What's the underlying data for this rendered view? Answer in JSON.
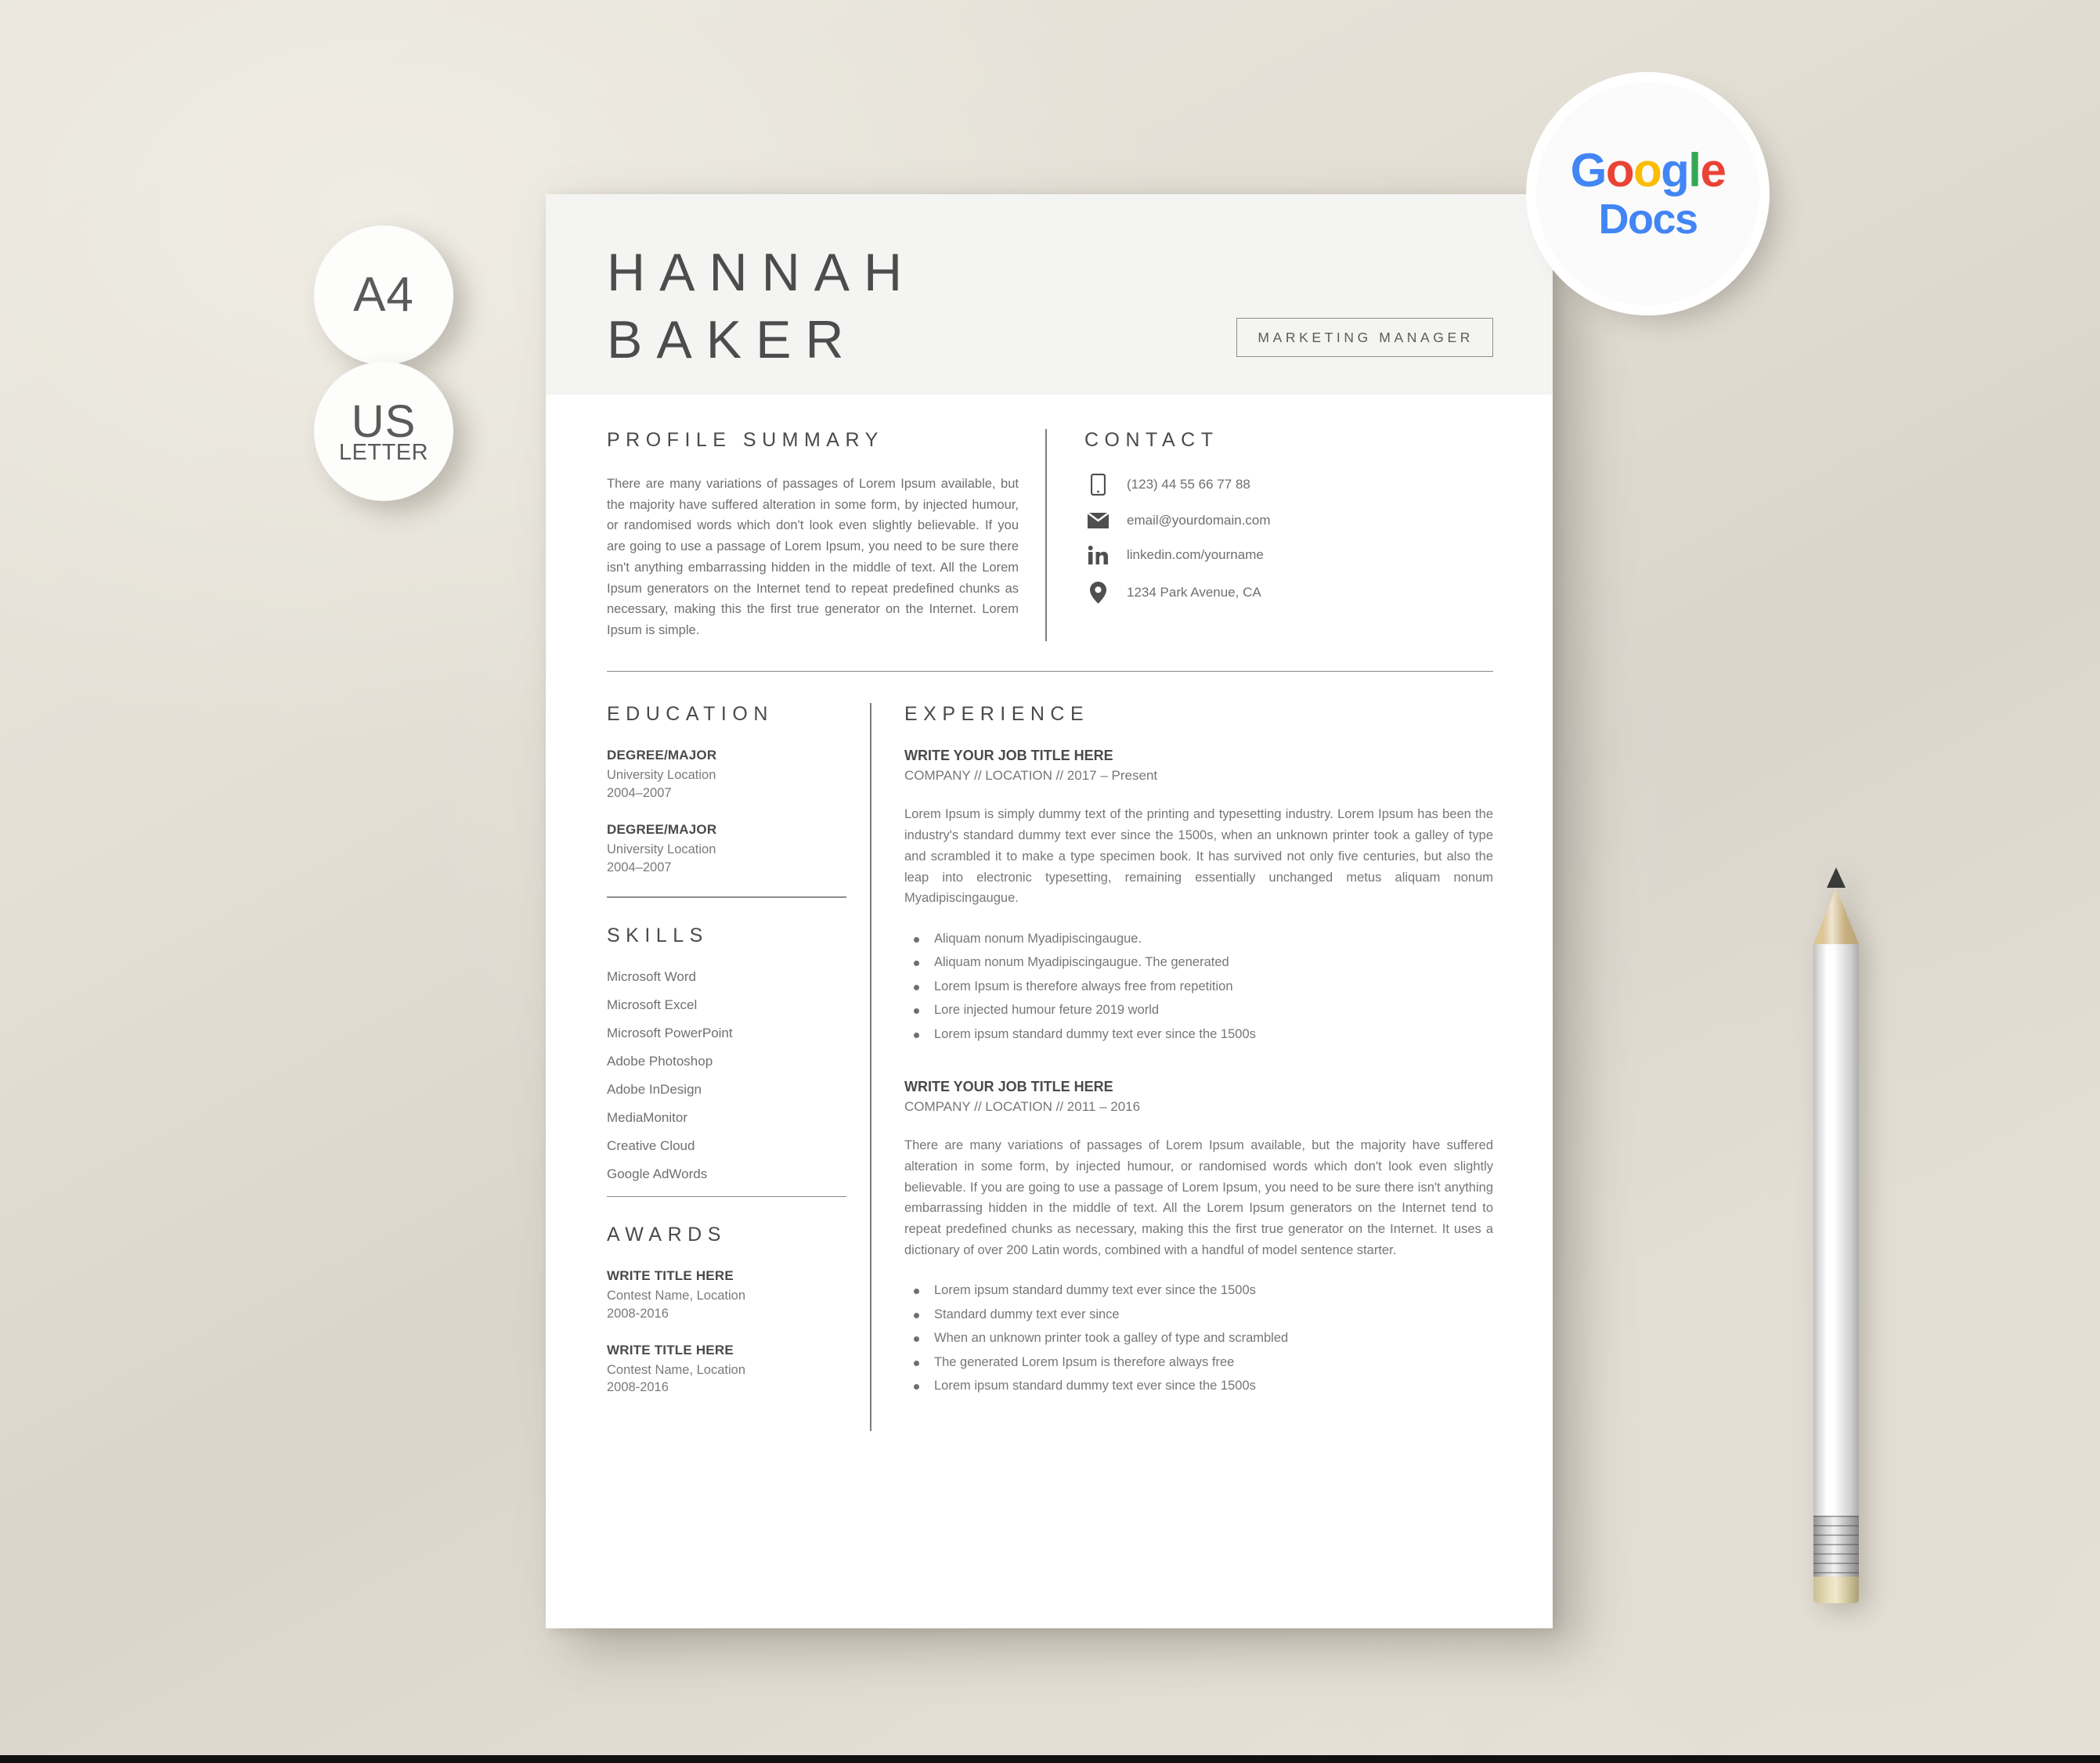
{
  "badges": {
    "a4": {
      "main": "A4",
      "sub": ""
    },
    "us_letter": {
      "main": "US",
      "sub": "LETTER"
    },
    "google_docs": {
      "google_letters": [
        "G",
        "o",
        "o",
        "g",
        "l",
        "e"
      ],
      "docs": "Docs"
    }
  },
  "brand_colors": {
    "google_blue": "#4285F4",
    "google_red": "#EA4335",
    "google_yellow": "#FBBC05",
    "google_green": "#34A853",
    "header_band": "#f4f4f2",
    "page": "#ffffff",
    "heading_text": "#4a4a4a",
    "body_text": "#6f6f6f",
    "rule": "#8b8b8b"
  },
  "resume": {
    "name": {
      "first": "HANNAH",
      "last": "BAKER"
    },
    "role_badge": "MARKETING MANAGER",
    "profile": {
      "title": "PROFILE SUMMARY",
      "text": "There are many variations of passages of Lorem Ipsum available, but the majority have suffered alteration in some form, by injected humour, or randomised words which don't look even slightly believable. If you are going to use a passage of Lorem Ipsum, you need to be sure there isn't anything embarrassing hidden in the middle of text. All the Lorem Ipsum generators on the Internet tend to repeat predefined chunks as necessary, making this the first true generator on the Internet. Lorem Ipsum is simple."
    },
    "contact": {
      "title": "CONTACT",
      "items": [
        {
          "icon": "phone-icon",
          "value": "(123) 44 55 66 77 88"
        },
        {
          "icon": "envelope-icon",
          "value": "email@yourdomain.com"
        },
        {
          "icon": "linkedin-icon",
          "value": "linkedin.com/yourname"
        },
        {
          "icon": "location-pin-icon",
          "value": "1234 Park Avenue, CA"
        }
      ]
    },
    "education": {
      "title": "EDUCATION",
      "entries": [
        {
          "degree": "DEGREE/MAJOR",
          "school": "University Location",
          "years": "2004–2007"
        },
        {
          "degree": "DEGREE/MAJOR",
          "school": "University Location",
          "years": "2004–2007"
        }
      ]
    },
    "skills": {
      "title": "SKILLS",
      "items": [
        "Microsoft Word",
        "Microsoft Excel",
        "Microsoft PowerPoint",
        "Adobe Photoshop",
        "Adobe InDesign",
        "MediaMonitor",
        "Creative Cloud",
        "Google AdWords"
      ]
    },
    "awards": {
      "title": "AWARDS",
      "entries": [
        {
          "title": "WRITE TITLE HERE",
          "contest": "Contest Name, Location",
          "years": "2008-2016"
        },
        {
          "title": "WRITE TITLE HERE",
          "contest": "Contest Name, Location",
          "years": "2008-2016"
        }
      ]
    },
    "experience": {
      "title": "EXPERIENCE",
      "jobs": [
        {
          "title": "WRITE YOUR JOB TITLE HERE",
          "meta": "COMPANY // LOCATION // 2017 – Present",
          "description": "Lorem Ipsum is simply dummy text of the printing and typesetting industry. Lorem Ipsum has been the industry's standard dummy text ever since the 1500s, when an unknown printer took a galley of type and scrambled it to make a type specimen book. It has survived not only five centuries, but also the leap into electronic typesetting, remaining essentially unchanged metus aliquam nonum Myadipiscingaugue.",
          "bullets": [
            "Aliquam nonum Myadipiscingaugue.",
            "Aliquam nonum Myadipiscingaugue. The generated",
            "Lorem Ipsum is therefore always free from repetition",
            "Lore injected humour feture 2019  world",
            "Lorem ipsum standard dummy text ever since the 1500s"
          ]
        },
        {
          "title": "WRITE YOUR JOB TITLE HERE",
          "meta": "COMPANY // LOCATION // 2011 – 2016",
          "description": "There are many variations of passages of Lorem Ipsum available, but the majority have suffered alteration in some form, by injected humour, or randomised words which don't look even slightly believable. If you are going to use a passage of Lorem Ipsum, you need to be sure there isn't anything embarrassing hidden in the middle of text. All the Lorem Ipsum generators on the Internet tend to repeat predefined chunks as necessary, making this the first true generator on the Internet. It uses a dictionary of over 200 Latin words, combined with a handful of model sentence starter.",
          "bullets": [
            "Lorem ipsum standard dummy text ever since the 1500s",
            "Standard dummy text ever since",
            "When an unknown printer took a galley of type and scrambled",
            "The generated Lorem Ipsum is therefore always free",
            "Lorem ipsum standard dummy text ever since the 1500s"
          ]
        }
      ]
    }
  }
}
